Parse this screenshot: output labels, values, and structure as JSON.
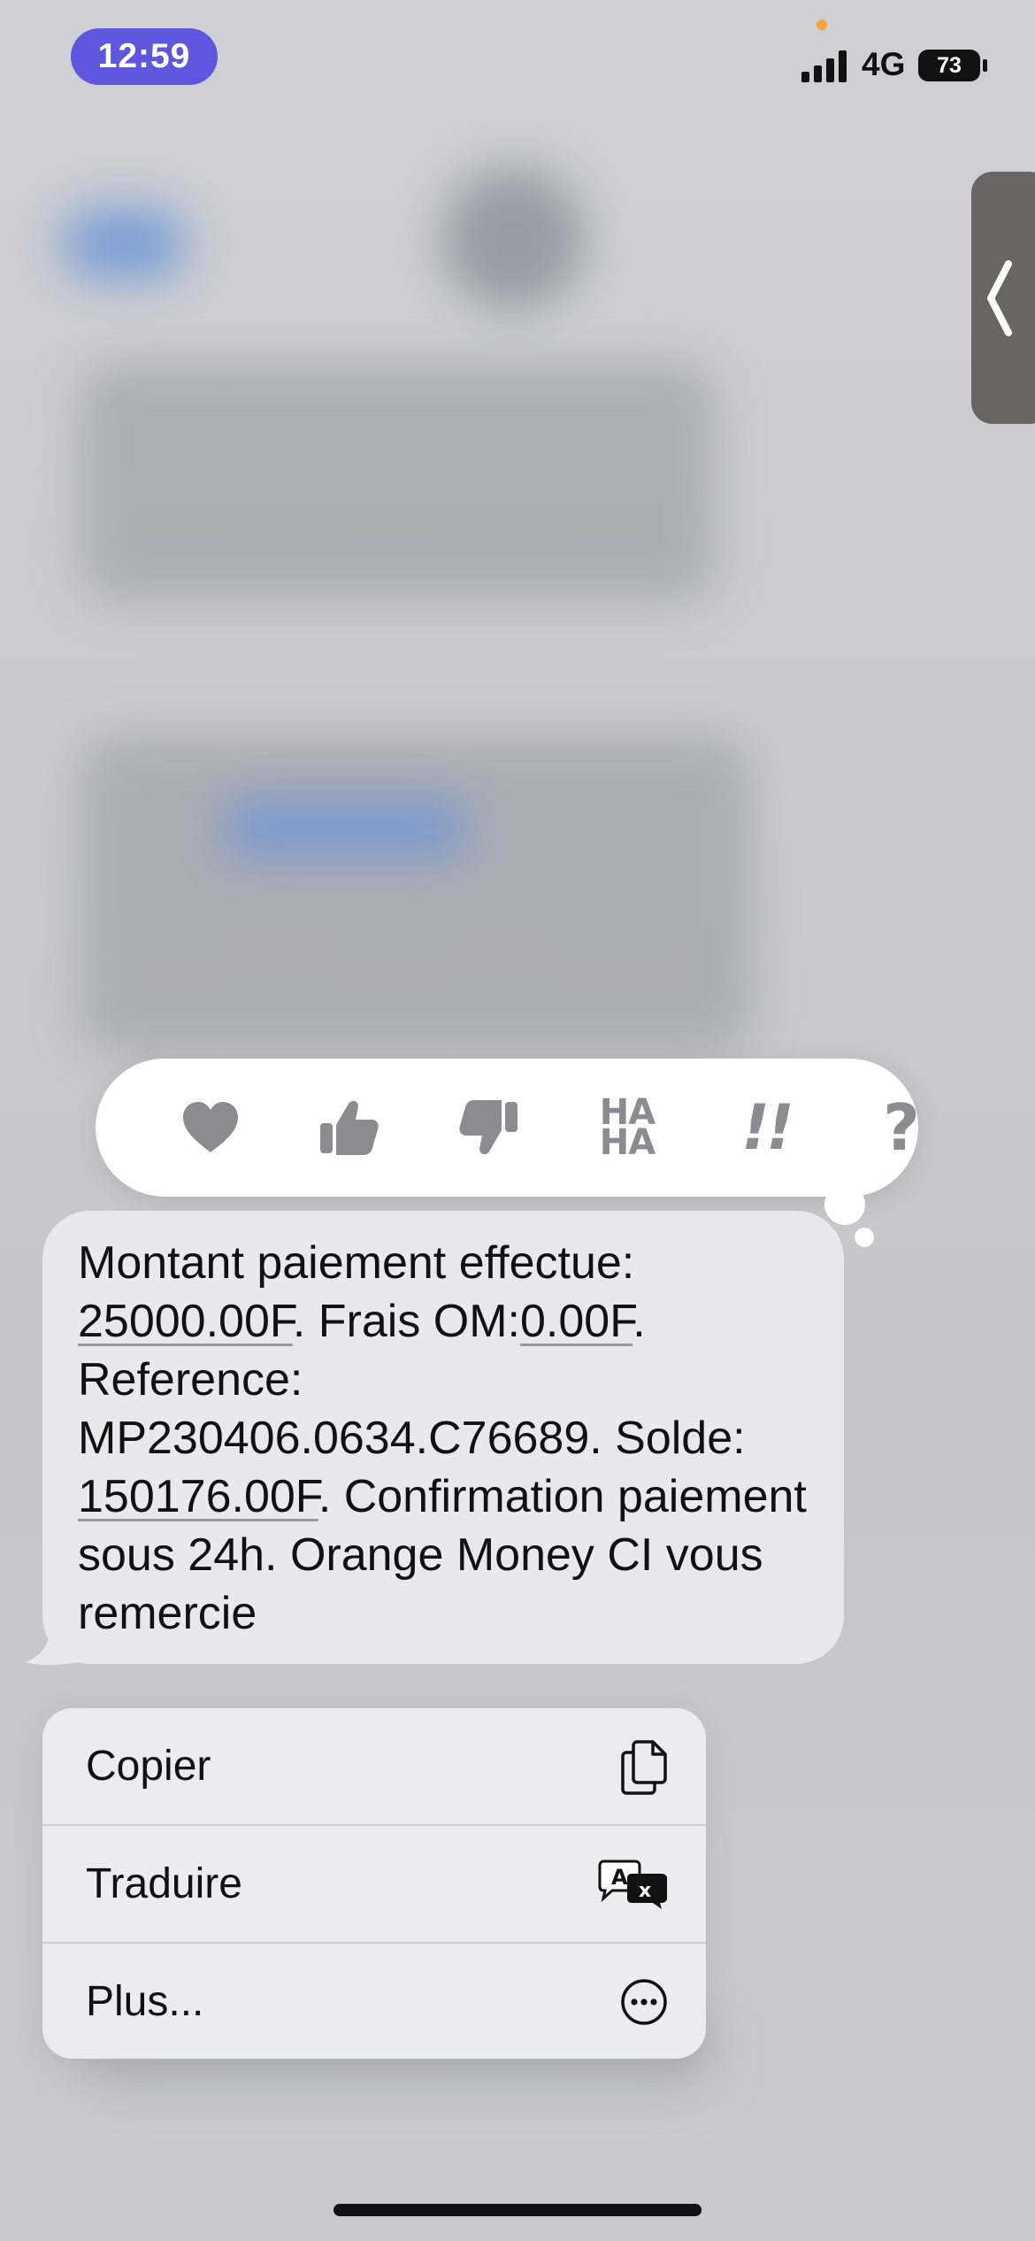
{
  "status_bar": {
    "time": "12:59",
    "network": "4G",
    "battery": "73"
  },
  "tapback": {
    "reactions": [
      {
        "icon": "heart-icon"
      },
      {
        "icon": "thumbs-up-icon"
      },
      {
        "icon": "thumbs-down-icon"
      },
      {
        "label_top": "HA",
        "label_bottom": "HA"
      },
      {
        "label": "!!"
      },
      {
        "label": "?"
      }
    ]
  },
  "message": {
    "parts": [
      {
        "text": "Montant paiement effectue: ",
        "link": false
      },
      {
        "text": "25000.00F",
        "link": true
      },
      {
        "text": ". Frais OM:",
        "link": false
      },
      {
        "text": "0.00F",
        "link": true
      },
      {
        "text": ". Reference: MP230406.0634.C76689. Solde: ",
        "link": false
      },
      {
        "text": "150176.00F",
        "link": true
      },
      {
        "text": ". Confirmation paiement sous 24h. Orange Money CI vous remercie",
        "link": false
      }
    ]
  },
  "menu": {
    "items": [
      {
        "label": "Copier",
        "icon": "copy-icon"
      },
      {
        "label": "Traduire",
        "icon": "translate-icon"
      },
      {
        "label": "Plus...",
        "icon": "more-icon"
      }
    ]
  },
  "colors": {
    "time_pill": "#5e56dc",
    "bubble": "#e9e9eb",
    "tapback_icon": "#8c8c90"
  }
}
